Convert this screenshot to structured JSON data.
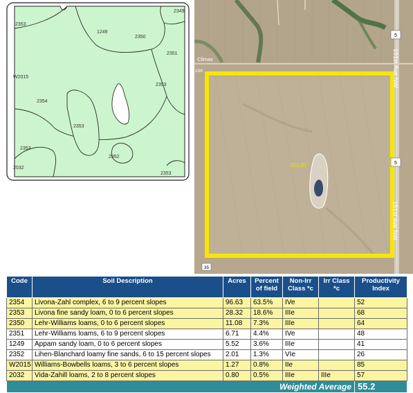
{
  "soil_map": {
    "labels": [
      "2349",
      "2353",
      "1249",
      "2350",
      "2351",
      "W2015",
      "2353",
      "2354",
      "2353",
      "2352",
      "2353",
      "2032",
      "2353"
    ]
  },
  "aerial": {
    "labels": {
      "climax": "Climax",
      "road_number_top": "5",
      "road_number_mid": "5",
      "road_name_top": "151st Ave NW",
      "road_name_bottom": "151st Ave NW",
      "township_left": "158",
      "section_bottom": "35",
      "acreage": "153.85"
    }
  },
  "table": {
    "headers": {
      "code": "Code",
      "description": "Soil Description",
      "acres": "Acres",
      "percent": "Percent of field",
      "non_irr": "Non-Irr Class *c",
      "irr": "Irr Class *c",
      "productivity": "Productivity Index"
    },
    "rows": [
      {
        "code": "2354",
        "description": "Livona-Zahl complex, 6 to 9 percent slopes",
        "acres": "96.63",
        "percent": "63.5%",
        "non_irr": "IVe",
        "irr": "",
        "productivity": "52"
      },
      {
        "code": "2353",
        "description": "Livona fine sandy loam, 0 to 6 percent slopes",
        "acres": "28.32",
        "percent": "18.6%",
        "non_irr": "IIIe",
        "irr": "",
        "productivity": "68"
      },
      {
        "code": "2350",
        "description": "Lehr-Williams loams, 0 to 6 percent slopes",
        "acres": "11.08",
        "percent": "7.3%",
        "non_irr": "IIIe",
        "irr": "",
        "productivity": "64"
      },
      {
        "code": "2351",
        "description": "Lehr-Williams loams, 6 to 9 percent slopes",
        "acres": "6.71",
        "percent": "4.4%",
        "non_irr": "IVe",
        "irr": "",
        "productivity": "48"
      },
      {
        "code": "1249",
        "description": "Appam sandy loam, 0 to 6 percent slopes",
        "acres": "5.52",
        "percent": "3.6%",
        "non_irr": "IIIe",
        "irr": "",
        "productivity": "41"
      },
      {
        "code": "2352",
        "description": "Lihen-Blanchard loamy fine sands, 6 to 15 percent slopes",
        "acres": "2.01",
        "percent": "1.3%",
        "non_irr": "VIe",
        "irr": "",
        "productivity": "26"
      },
      {
        "code": "W2015",
        "description": "Williams-Bowbells loams, 3 to 6 percent slopes",
        "acres": "1.27",
        "percent": "0.8%",
        "non_irr": "IIe",
        "irr": "",
        "productivity": "85"
      },
      {
        "code": "2032",
        "description": "Vida-Zahill loams, 2 to 8 percent slopes",
        "acres": "0.80",
        "percent": "0.5%",
        "non_irr": "IIIe",
        "irr": "IIIe",
        "productivity": "57"
      }
    ],
    "footer": {
      "label": "Weighted Average",
      "value": "55.2"
    }
  },
  "colors": {
    "header_blue": "#1a4f8a",
    "row_yellow": "#fbf5a2",
    "footer_teal": "#2f8d99",
    "map_green": "#cdf5cd",
    "boundary_yellow": "#f7e600"
  }
}
